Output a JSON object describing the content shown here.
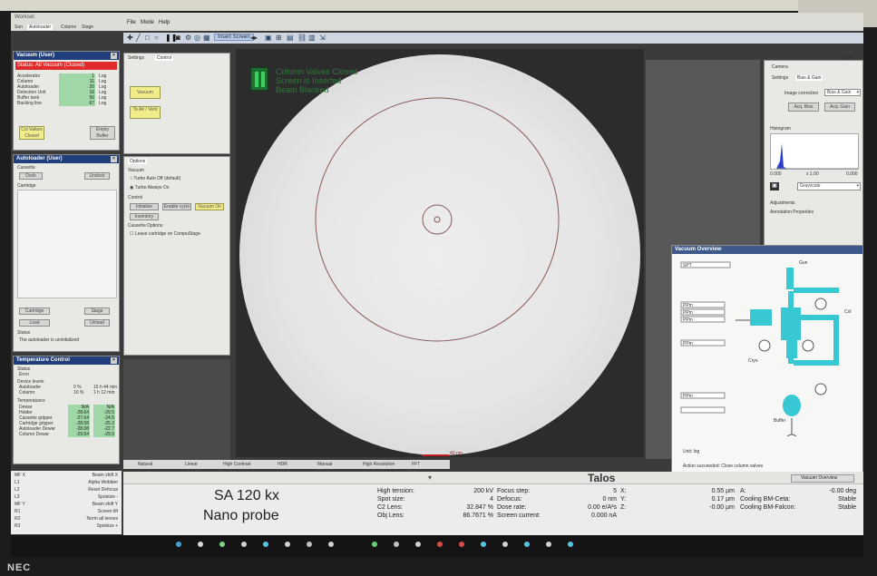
{
  "screenshot_window": {
    "title": "Workset"
  },
  "app_menu": [
    "File",
    "Mode",
    "Help"
  ],
  "left_tabs": [
    "Sun",
    "Autoloader",
    "Column",
    "Stage"
  ],
  "vacuum_panel": {
    "title": "Vacuum (User)",
    "status": "Status: All Vacuum (Closed)",
    "rows": [
      {
        "label": "Accelerator",
        "value": "1",
        "unit": "Log"
      },
      {
        "label": "Column",
        "value": "11",
        "unit": "Log"
      },
      {
        "label": "Autoloader",
        "value": "20",
        "unit": "Log"
      },
      {
        "label": "Detection Unit",
        "value": "16",
        "unit": "Log"
      },
      {
        "label": "Buffer tank",
        "value": "56",
        "unit": "Log"
      },
      {
        "label": "Backing line",
        "value": "67",
        "unit": "Log"
      }
    ],
    "col_valves_btn": "Col Valves Closed",
    "empty_buffer_btn": "Empty Buffer"
  },
  "control_panel": {
    "tabs": [
      "Settings",
      "Control"
    ],
    "vacuum_btn": "Vacuum",
    "airbtn": "To Air / Vent"
  },
  "autoloader_panel": {
    "title": "Autoloader (User)",
    "cassette_label": "Cassette",
    "dock_btn": "Dock",
    "undock_btn": "Undock",
    "cartridge_label": "Cartridge",
    "cartridge_btn": "Cartridge",
    "stage_btn": "Stage",
    "load_btn": "Load",
    "unload_btn": "Unload",
    "status_label": "Status",
    "status_text": "The autoloader is uninitialized"
  },
  "options_panel": {
    "title": "Options",
    "vacuum_label": "Vacuum",
    "opt1": "Turbo Auto Off (default)",
    "opt2": "Turbo Always On",
    "control_label": "Control",
    "initialize_btn": "Initialize",
    "inventory_btn": "Inventory",
    "buttons": [
      "Initialize",
      "Enable cycle",
      "Vacuum On"
    ],
    "cassette_label": "Cassette Options",
    "checkbox": "Leave cartridge on CompuStage"
  },
  "temperature_panel": {
    "title": "Temperature Control",
    "status_label": "Status",
    "status_value": "Error",
    "device_label": "Device levels",
    "devices": [
      {
        "label": "Autoloader",
        "v1": "0 %",
        "v2": "15 h 44 min"
      },
      {
        "label": "Column",
        "v1": "10 %",
        "v2": "1 h 12 min"
      }
    ],
    "temps_label": "Temperatures",
    "temps": [
      {
        "label": "Dewar",
        "v1": "N/A",
        "v2": "N/A"
      },
      {
        "label": "Holder",
        "v1": "-28.64",
        "v2": "-29.5"
      },
      {
        "label": "Cassette gripper",
        "v1": "-27.64",
        "v2": "-24.5"
      },
      {
        "label": "Cartridge gripper",
        "v1": "-28.58",
        "v2": "-25.3"
      },
      {
        "label": "Autoloader Dewar",
        "v1": "-28.08",
        "v2": "-22.7"
      },
      {
        "label": "Column Dewar",
        "v1": "-29.54",
        "v2": "-29.5"
      }
    ]
  },
  "left_list": [
    {
      "key": "MF X",
      "value": "Beam shift X"
    },
    {
      "key": "L1",
      "value": "Alpha Wobbler"
    },
    {
      "key": "L2",
      "value": "Reset Defocus"
    },
    {
      "key": "L3",
      "value": "Spotsize -"
    },
    {
      "key": "MF Y",
      "value": "Beam shift Y"
    },
    {
      "key": "R1",
      "value": "Screen lift"
    },
    {
      "key": "R2",
      "value": "Norm all lenses"
    },
    {
      "key": "R3",
      "value": "Spotsize +"
    }
  ],
  "toolbar": {
    "insert_screen": "Insert Screen"
  },
  "image_overlay": {
    "line1": "Column Valves Closed",
    "line2": "Screen is Inserted",
    "line3": "Beam Blanked",
    "scalebar": "40 nm"
  },
  "view_tabs": [
    "Natural",
    "Linear",
    "High Contrast",
    "HDR",
    "Manual",
    "High Resolution",
    "FFT"
  ],
  "camera_panel": {
    "title": "Camera",
    "close": "Close",
    "tabs": [
      "Settings",
      "Bias & Gain"
    ],
    "image_correction_label": "Image correction",
    "image_correction_value": "Bias & Gain",
    "acq_bias_btn": "Acq. Bias",
    "acq_gain_btn": "Acq. Gain",
    "histogram_label": "Histogram",
    "hist_ticks": [
      "0.000",
      "x 1.00",
      "0.000"
    ],
    "colormap": "Grayscale",
    "adjustments": "Adjustments",
    "annotation": "Annotation Properties"
  },
  "vacuum_overview": {
    "title": "Vacuum Overview",
    "labels": [
      "SPT",
      "PPm",
      "PPm",
      "PPm",
      "PPm",
      "PPm",
      "Cryo",
      "Gun",
      "Col",
      "Buffer"
    ],
    "unit": "Unit: log",
    "message": "Action succeeded: Close column valves"
  },
  "talos": {
    "title": "Talos",
    "dropdown": "Vacuum Overview",
    "mag": "SA 120 kx",
    "probe": "Nano probe",
    "params": [
      {
        "label": "High tension:",
        "value": "200 kV"
      },
      {
        "label": "Spot size:",
        "value": "4"
      },
      {
        "label": "C2 Lens:",
        "value": "32.847 %"
      },
      {
        "label": "Obj Lens:",
        "value": "86.7671 %"
      }
    ],
    "params2": [
      {
        "label": "Focus step:",
        "value": "5"
      },
      {
        "label": "Defocus:",
        "value": "0 nm"
      },
      {
        "label": "Dose rate:",
        "value": "0.00 e/A²s"
      },
      {
        "label": "Screen current:",
        "value": "0.000 nA"
      }
    ],
    "stage": [
      {
        "label": "X:",
        "value": "0.55 µm"
      },
      {
        "label": "Y:",
        "value": "0.17 µm"
      },
      {
        "label": "Z:",
        "value": "-0.00 µm"
      }
    ],
    "stage2": [
      {
        "label": "A:",
        "value": "-0.00 deg"
      },
      {
        "label": "Cooling BM-Ceta:",
        "value": "Stable"
      },
      {
        "label": "Cooling BM-Falcon:",
        "value": "Stable"
      }
    ]
  },
  "monitor_brand": "NEC"
}
